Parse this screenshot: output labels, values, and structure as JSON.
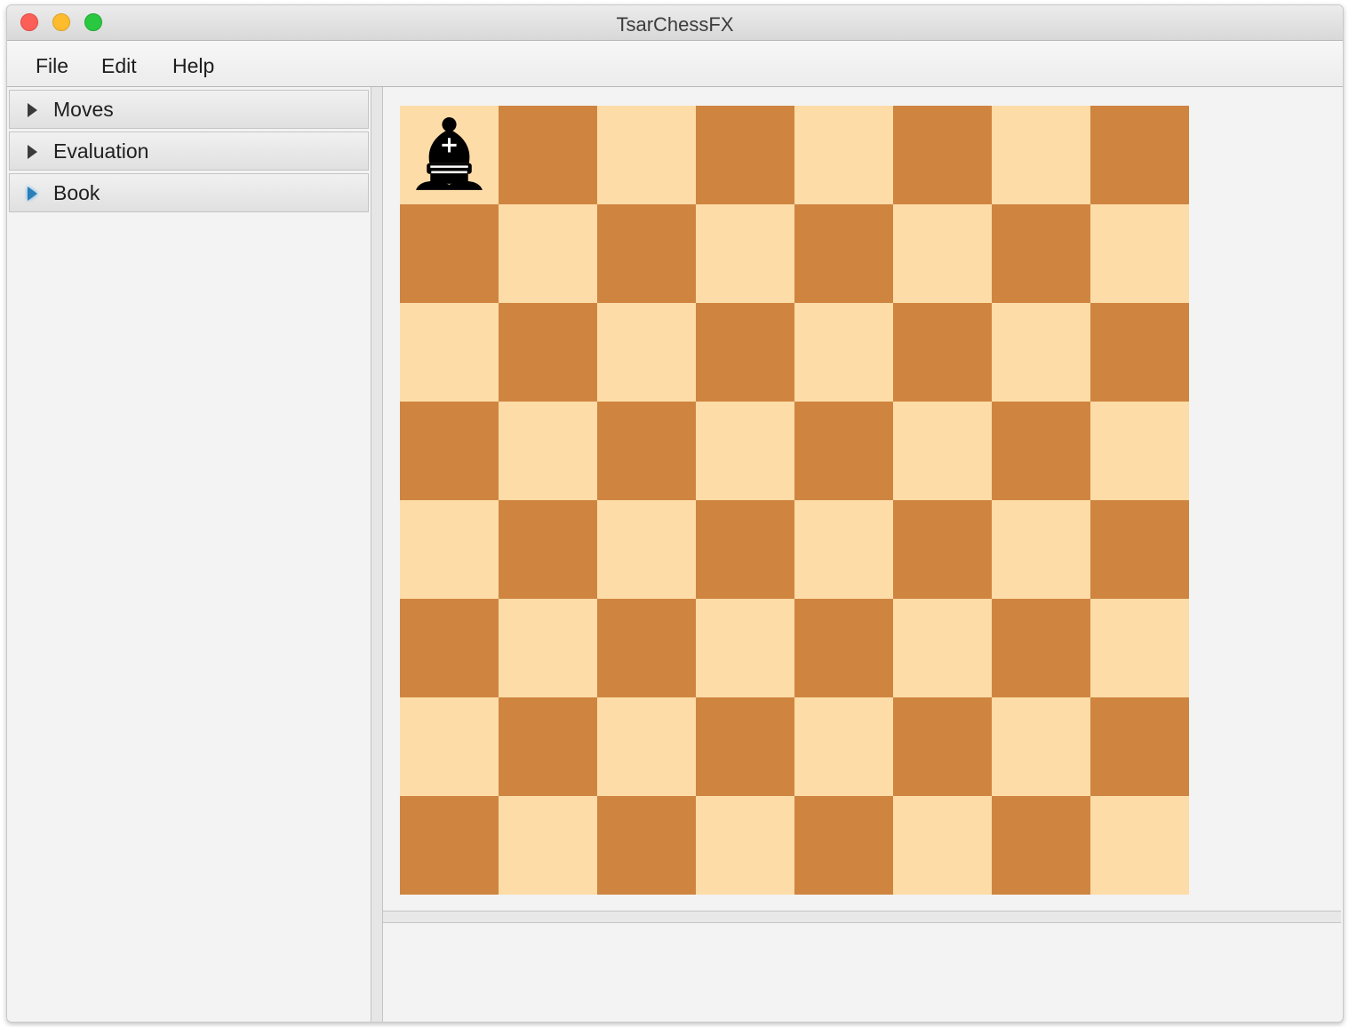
{
  "window": {
    "title": "TsarChessFX"
  },
  "menu": {
    "items": [
      "File",
      "Edit",
      "Help"
    ]
  },
  "sidebar": {
    "sections": [
      {
        "label": "Moves",
        "focused": false
      },
      {
        "label": "Evaluation",
        "focused": false
      },
      {
        "label": "Book",
        "focused": true
      }
    ]
  },
  "board": {
    "files": 8,
    "ranks": 8,
    "light_color": "#fddca8",
    "dark_color": "#cf8540",
    "pieces": [
      {
        "piece": "black-bishop",
        "square": "a8"
      }
    ]
  },
  "colors": {
    "accent": "#2a7fb8"
  }
}
